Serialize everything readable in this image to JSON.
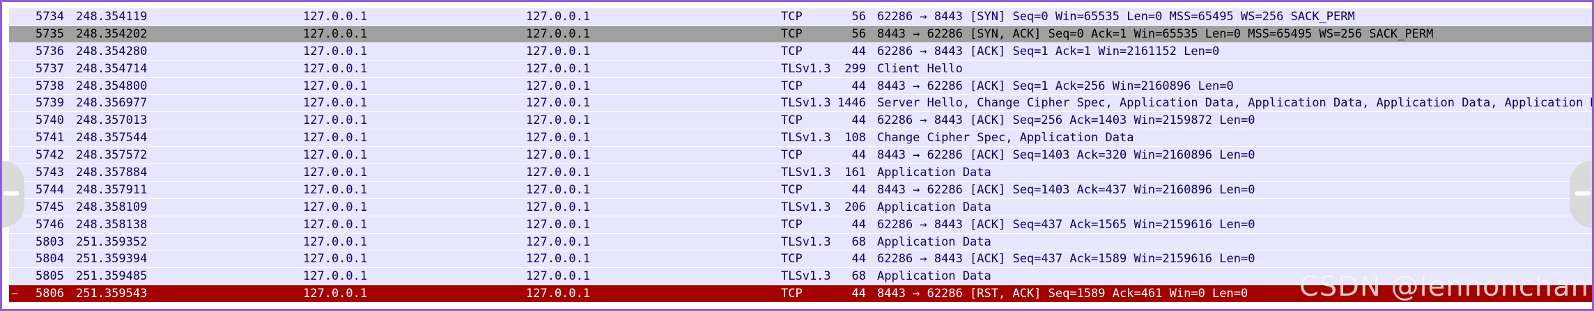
{
  "packets": [
    {
      "no": "5734",
      "time": "248.354119",
      "src": "127.0.0.1",
      "dst": "127.0.0.1",
      "proto": "TCP",
      "len": "56",
      "info": "62286 → 8443 [SYN] Seq=0 Win=65535 Len=0 MSS=65495 WS=256 SACK_PERM",
      "style": "normal"
    },
    {
      "no": "5735",
      "time": "248.354202",
      "src": "127.0.0.1",
      "dst": "127.0.0.1",
      "proto": "TCP",
      "len": "56",
      "info": "8443 → 62286 [SYN, ACK] Seq=0 Ack=1 Win=65535 Len=0 MSS=65495 WS=256 SACK_PERM",
      "style": "sel-gray"
    },
    {
      "no": "5736",
      "time": "248.354280",
      "src": "127.0.0.1",
      "dst": "127.0.0.1",
      "proto": "TCP",
      "len": "44",
      "info": "62286 → 8443 [ACK] Seq=1 Ack=1 Win=2161152 Len=0",
      "style": "normal"
    },
    {
      "no": "5737",
      "time": "248.354714",
      "src": "127.0.0.1",
      "dst": "127.0.0.1",
      "proto": "TLSv1.3",
      "len": "299",
      "info": "Client Hello",
      "style": "normal"
    },
    {
      "no": "5738",
      "time": "248.354800",
      "src": "127.0.0.1",
      "dst": "127.0.0.1",
      "proto": "TCP",
      "len": "44",
      "info": "8443 → 62286 [ACK] Seq=1 Ack=256 Win=2160896 Len=0",
      "style": "normal"
    },
    {
      "no": "5739",
      "time": "248.356977",
      "src": "127.0.0.1",
      "dst": "127.0.0.1",
      "proto": "TLSv1.3",
      "len": "1446",
      "info": "Server Hello, Change Cipher Spec, Application Data, Application Data, Application Data, Application Dat",
      "style": "normal"
    },
    {
      "no": "5740",
      "time": "248.357013",
      "src": "127.0.0.1",
      "dst": "127.0.0.1",
      "proto": "TCP",
      "len": "44",
      "info": "62286 → 8443 [ACK] Seq=256 Ack=1403 Win=2159872 Len=0",
      "style": "normal"
    },
    {
      "no": "5741",
      "time": "248.357544",
      "src": "127.0.0.1",
      "dst": "127.0.0.1",
      "proto": "TLSv1.3",
      "len": "108",
      "info": "Change Cipher Spec, Application Data",
      "style": "normal"
    },
    {
      "no": "5742",
      "time": "248.357572",
      "src": "127.0.0.1",
      "dst": "127.0.0.1",
      "proto": "TCP",
      "len": "44",
      "info": "8443 → 62286 [ACK] Seq=1403 Ack=320 Win=2160896 Len=0",
      "style": "normal"
    },
    {
      "no": "5743",
      "time": "248.357884",
      "src": "127.0.0.1",
      "dst": "127.0.0.1",
      "proto": "TLSv1.3",
      "len": "161",
      "info": "Application Data",
      "style": "normal"
    },
    {
      "no": "5744",
      "time": "248.357911",
      "src": "127.0.0.1",
      "dst": "127.0.0.1",
      "proto": "TCP",
      "len": "44",
      "info": "8443 → 62286 [ACK] Seq=1403 Ack=437 Win=2160896 Len=0",
      "style": "normal"
    },
    {
      "no": "5745",
      "time": "248.358109",
      "src": "127.0.0.1",
      "dst": "127.0.0.1",
      "proto": "TLSv1.3",
      "len": "206",
      "info": "Application Data",
      "style": "normal"
    },
    {
      "no": "5746",
      "time": "248.358138",
      "src": "127.0.0.1",
      "dst": "127.0.0.1",
      "proto": "TCP",
      "len": "44",
      "info": "62286 → 8443 [ACK] Seq=437 Ack=1565 Win=2159616 Len=0",
      "style": "normal"
    },
    {
      "no": "5803",
      "time": "251.359352",
      "src": "127.0.0.1",
      "dst": "127.0.0.1",
      "proto": "TLSv1.3",
      "len": "68",
      "info": "Application Data",
      "style": "normal"
    },
    {
      "no": "5804",
      "time": "251.359394",
      "src": "127.0.0.1",
      "dst": "127.0.0.1",
      "proto": "TCP",
      "len": "44",
      "info": "62286 → 8443 [ACK] Seq=437 Ack=1589 Win=2159616 Len=0",
      "style": "normal"
    },
    {
      "no": "5805",
      "time": "251.359485",
      "src": "127.0.0.1",
      "dst": "127.0.0.1",
      "proto": "TLSv1.3",
      "len": "68",
      "info": "Application Data",
      "style": "normal"
    },
    {
      "no": "5806",
      "time": "251.359543",
      "src": "127.0.0.1",
      "dst": "127.0.0.1",
      "proto": "TCP",
      "len": "44",
      "info": "8443 → 62286 [RST, ACK] Seq=1589 Ack=461 Win=0 Len=0",
      "style": "sel-red"
    }
  ],
  "watermark": "CSDN @lennonchan",
  "colors": {
    "row_bg": "#e7e6ff",
    "row_text": "#12005e",
    "selected_gray": "#a0a0a0",
    "rst_red": "#a40000",
    "frame_border": "#8f5fd6"
  },
  "icons": {
    "left_handle": "scroll-left-icon",
    "right_handle": "scroll-right-icon"
  }
}
